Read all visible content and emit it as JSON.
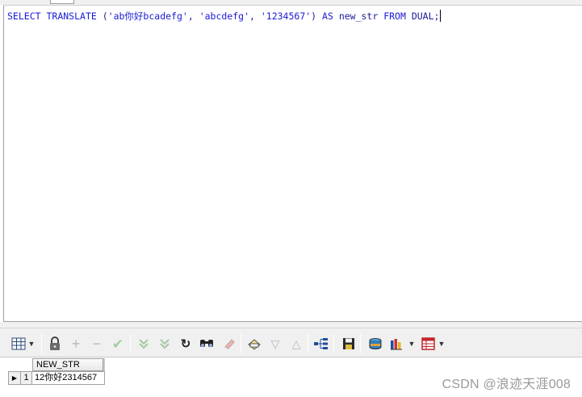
{
  "editor": {
    "sql": {
      "kw_select": "SELECT",
      "kw_translate": "TRANSLATE",
      "open": " (",
      "arg1": "'ab你好bcadefg'",
      "comma1": ", ",
      "arg2": "'abcdefg'",
      "comma2": ", ",
      "arg3": "'1234567'",
      "close": ") ",
      "kw_as": "AS",
      "alias": " new_str ",
      "kw_from": "FROM",
      "table": " DUAL;"
    }
  },
  "toolbar": {
    "buttons": [
      {
        "name": "grid-layout-icon",
        "glyph": "▦",
        "enabled": true
      },
      {
        "name": "lock-icon",
        "glyph": "🔒",
        "enabled": true
      },
      {
        "name": "add-record-icon",
        "glyph": "+",
        "enabled": false
      },
      {
        "name": "delete-record-icon",
        "glyph": "−",
        "enabled": false
      },
      {
        "name": "post-changes-icon",
        "glyph": "✔",
        "enabled": false
      },
      {
        "name": "fetch-next-icon",
        "glyph": "⩔",
        "enabled": false
      },
      {
        "name": "fetch-last-icon",
        "glyph": "⩔",
        "enabled": false
      },
      {
        "name": "refresh-icon",
        "glyph": "↻",
        "enabled": true
      },
      {
        "name": "find-icon",
        "glyph": "🔍",
        "enabled": true
      },
      {
        "name": "clear-icon",
        "glyph": "✎",
        "enabled": false
      },
      {
        "name": "query-by-example-icon",
        "glyph": "⎙",
        "enabled": true
      },
      {
        "name": "filter-down-icon",
        "glyph": "▽",
        "enabled": false
      },
      {
        "name": "filter-up-icon",
        "glyph": "△",
        "enabled": false
      },
      {
        "name": "tree-view-icon",
        "glyph": "⋮",
        "enabled": true
      },
      {
        "name": "save-icon",
        "glyph": "💾",
        "enabled": true
      },
      {
        "name": "export-icon",
        "glyph": "⛁",
        "enabled": true
      },
      {
        "name": "chart-icon",
        "glyph": "▮",
        "enabled": true
      },
      {
        "name": "table-icon",
        "glyph": "▤",
        "enabled": true
      }
    ]
  },
  "grid": {
    "columns": [
      "NEW_STR"
    ],
    "rows": [
      {
        "num": "1",
        "cells": [
          "12你好2314567"
        ]
      }
    ]
  },
  "watermark": "CSDN @浪迹天涯008"
}
